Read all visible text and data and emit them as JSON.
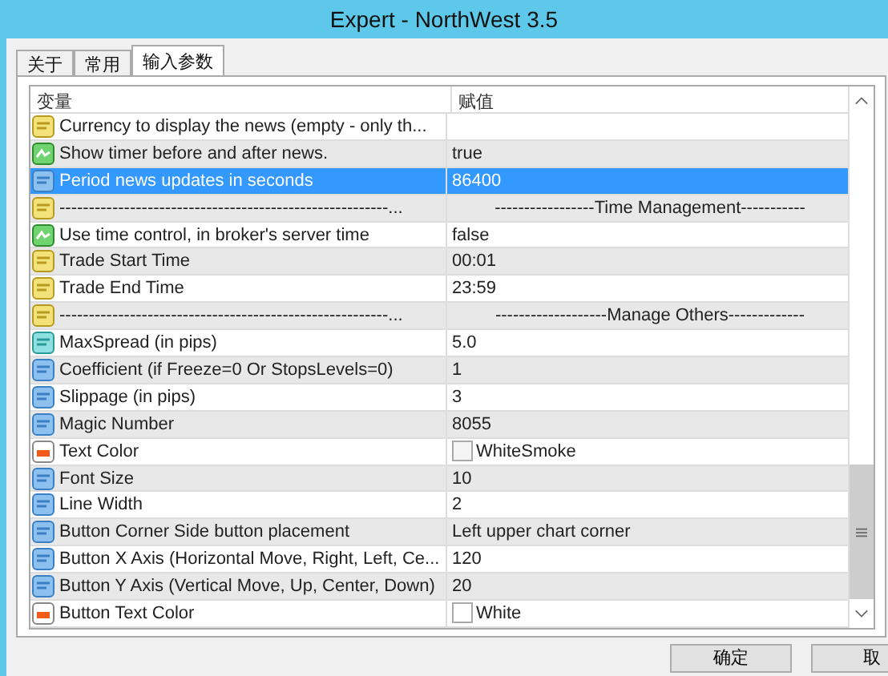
{
  "window": {
    "title": "Expert - NorthWest 3.5"
  },
  "tabs": [
    {
      "label": "关于",
      "selected": false
    },
    {
      "label": "常用",
      "selected": false
    },
    {
      "label": "输入参数",
      "selected": true
    }
  ],
  "table": {
    "columns": [
      "变量",
      "赋值"
    ],
    "rows": [
      {
        "kind": "string",
        "name": "Currency to display the news (empty - only th...",
        "value": "",
        "selected": false
      },
      {
        "kind": "bool",
        "name": "Show timer before and after news.",
        "value": "true",
        "selected": false
      },
      {
        "kind": "int",
        "name": "Period news updates in seconds",
        "value": "86400",
        "selected": true
      },
      {
        "kind": "string",
        "name": "--------------------------------------------------------...",
        "value": "-----------------Time Management-----------",
        "selected": false
      },
      {
        "kind": "bool",
        "name": "Use time control, in broker's server time",
        "value": "false",
        "selected": false
      },
      {
        "kind": "string",
        "name": "Trade Start Time",
        "value": "00:01",
        "selected": false
      },
      {
        "kind": "string",
        "name": "Trade End Time",
        "value": "23:59",
        "selected": false
      },
      {
        "kind": "string",
        "name": "--------------------------------------------------------...",
        "value": "-------------------Manage Others-------------",
        "selected": false
      },
      {
        "kind": "double",
        "name": "MaxSpread (in pips)",
        "value": "5.0",
        "selected": false
      },
      {
        "kind": "int",
        "name": "Coefficient (if Freeze=0 Or StopsLevels=0)",
        "value": "1",
        "selected": false
      },
      {
        "kind": "int",
        "name": "Slippage (in pips)",
        "value": "3",
        "selected": false
      },
      {
        "kind": "int",
        "name": "Magic Number",
        "value": "8055",
        "selected": false
      },
      {
        "kind": "color",
        "name": "Text Color",
        "value": "WhiteSmoke",
        "color": "#f5f5f5",
        "selected": false
      },
      {
        "kind": "int",
        "name": "Font Size",
        "value": "10",
        "selected": false
      },
      {
        "kind": "int",
        "name": "Line Width",
        "value": "2",
        "selected": false
      },
      {
        "kind": "int",
        "name": "Button Corner Side button placement",
        "value": "Left upper chart corner",
        "selected": false
      },
      {
        "kind": "int",
        "name": "Button X Axis (Horizontal Move, Right, Left, Ce...",
        "value": "120",
        "selected": false
      },
      {
        "kind": "int",
        "name": "Button Y Axis (Vertical Move, Up, Center, Down)",
        "value": "20",
        "selected": false
      },
      {
        "kind": "color",
        "name": "Button Text Color",
        "value": "White",
        "color": "#ffffff",
        "selected": false
      }
    ]
  },
  "buttons": [
    "确定",
    "取"
  ]
}
